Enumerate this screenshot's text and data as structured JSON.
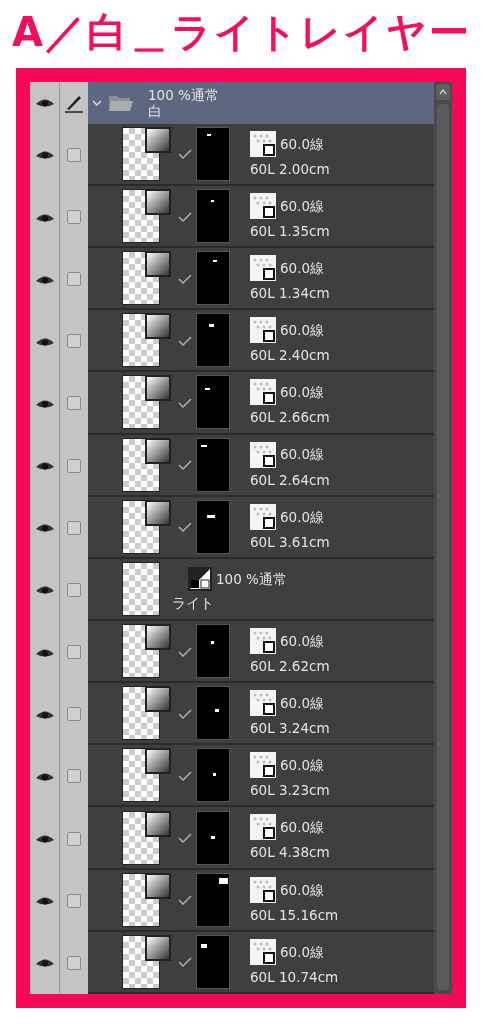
{
  "title": "A／白＿ライトレイヤー",
  "folder": {
    "expanded": true,
    "visible": true,
    "opacity_mode": "100 %通常",
    "name": "白"
  },
  "layers": [
    {
      "kind": "tone",
      "visible": true,
      "checked": false,
      "line1": "60.0線",
      "line2": "60L 2.00cm"
    },
    {
      "kind": "tone",
      "visible": true,
      "checked": false,
      "line1": "60.0線",
      "line2": "60L 1.35cm"
    },
    {
      "kind": "tone",
      "visible": true,
      "checked": false,
      "line1": "60.0線",
      "line2": "60L 1.34cm"
    },
    {
      "kind": "tone",
      "visible": true,
      "checked": false,
      "line1": "60.0線",
      "line2": "60L 2.40cm"
    },
    {
      "kind": "tone",
      "visible": true,
      "checked": false,
      "line1": "60.0線",
      "line2": "60L 2.66cm"
    },
    {
      "kind": "tone",
      "visible": true,
      "checked": false,
      "line1": "60.0線",
      "line2": "60L 2.64cm"
    },
    {
      "kind": "tone",
      "visible": true,
      "checked": false,
      "line1": "60.0線",
      "line2": "60L 3.61cm"
    },
    {
      "kind": "raster",
      "visible": true,
      "checked": false,
      "line1": "100 %通常",
      "line2": "ライト"
    },
    {
      "kind": "tone",
      "visible": true,
      "checked": false,
      "line1": "60.0線",
      "line2": "60L 2.62cm"
    },
    {
      "kind": "tone",
      "visible": true,
      "checked": false,
      "line1": "60.0線",
      "line2": "60L 3.24cm"
    },
    {
      "kind": "tone",
      "visible": true,
      "checked": false,
      "line1": "60.0線",
      "line2": "60L 3.23cm"
    },
    {
      "kind": "tone",
      "visible": true,
      "checked": false,
      "line1": "60.0線",
      "line2": "60L 4.38cm"
    },
    {
      "kind": "tone",
      "visible": true,
      "checked": false,
      "line1": "60.0線",
      "line2": "60L 15.16cm"
    },
    {
      "kind": "tone",
      "visible": true,
      "checked": false,
      "line1": "60.0線",
      "line2": "60L 10.74cm"
    }
  ]
}
